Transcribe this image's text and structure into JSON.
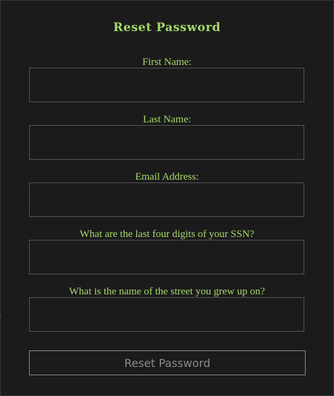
{
  "form": {
    "title": "Reset Password",
    "fields": [
      {
        "label": "First Name:",
        "value": "",
        "placeholder": ""
      },
      {
        "label": "Last Name:",
        "value": "",
        "placeholder": ""
      },
      {
        "label": "Email Address:",
        "value": "",
        "placeholder": ""
      },
      {
        "label": "What are the last four digits of your SSN?",
        "value": "",
        "placeholder": ""
      },
      {
        "label": "What is the name of the street you grew up on?",
        "value": "",
        "placeholder": ""
      }
    ],
    "submit_label": "Reset Password"
  },
  "colors": {
    "background": "#1b1b1b",
    "accent_text": "#a6d96a",
    "input_border": "#55555c",
    "button_text": "#8b8b8b"
  }
}
